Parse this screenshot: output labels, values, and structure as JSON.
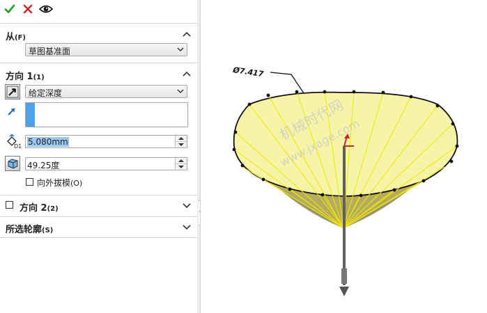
{
  "toolbar": {
    "ok_icon": "checkmark-icon",
    "cancel_icon": "close-icon",
    "preview_icon": "eye-icon"
  },
  "from_section": {
    "title": "从",
    "shortcut": "(F)",
    "select_value": "草图基准面"
  },
  "direction1": {
    "title": "方向 1",
    "shortcut": "(1)",
    "end_condition": "给定深度",
    "depth_value": "5.080mm",
    "draft_value": "49.25度",
    "draft_outward_label": "向外拔模",
    "draft_outward_shortcut": "(O)"
  },
  "direction2": {
    "title": "方向 2",
    "shortcut": "(2)"
  },
  "selected_contours": {
    "title": "所选轮廓",
    "shortcut": "(S)"
  },
  "viewport": {
    "dimension_label": "Ø7.417",
    "watermark_line1": "机械时代网",
    "watermark_line2": "www.jxage.com"
  },
  "colors": {
    "accent_green": "#1e9e1e",
    "accent_red": "#d42020",
    "selection_blue": "#99c8f0",
    "cone_fill": "#f6f4a6",
    "cone_lines": "#f0e800"
  }
}
